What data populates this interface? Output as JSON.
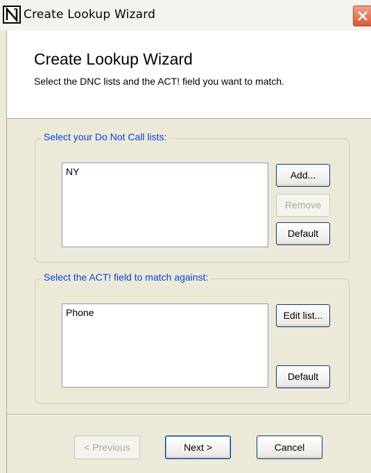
{
  "window": {
    "title": "Create Lookup Wizard",
    "title_icon": "wizard-app-icon",
    "close_icon": "close-x-icon",
    "colors": {
      "close": "#d9583a",
      "legend": "#0046d5",
      "face": "#ece9d8"
    }
  },
  "header": {
    "title": "Create Lookup Wizard",
    "subtitle": "Select the DNC lists and the ACT! field you want to match."
  },
  "dnc_group": {
    "legend": "Select your Do Not Call lists:",
    "items": [
      "NY"
    ],
    "buttons": {
      "add": "Add...",
      "remove": "Remove",
      "default": "Default"
    }
  },
  "field_group": {
    "legend": "Select the ACT! field to match against:",
    "items": [
      "Phone"
    ],
    "buttons": {
      "edit": "Edit list...",
      "default": "Default"
    }
  },
  "footer": {
    "previous": "< Previous",
    "next": "Next >",
    "cancel": "Cancel"
  }
}
